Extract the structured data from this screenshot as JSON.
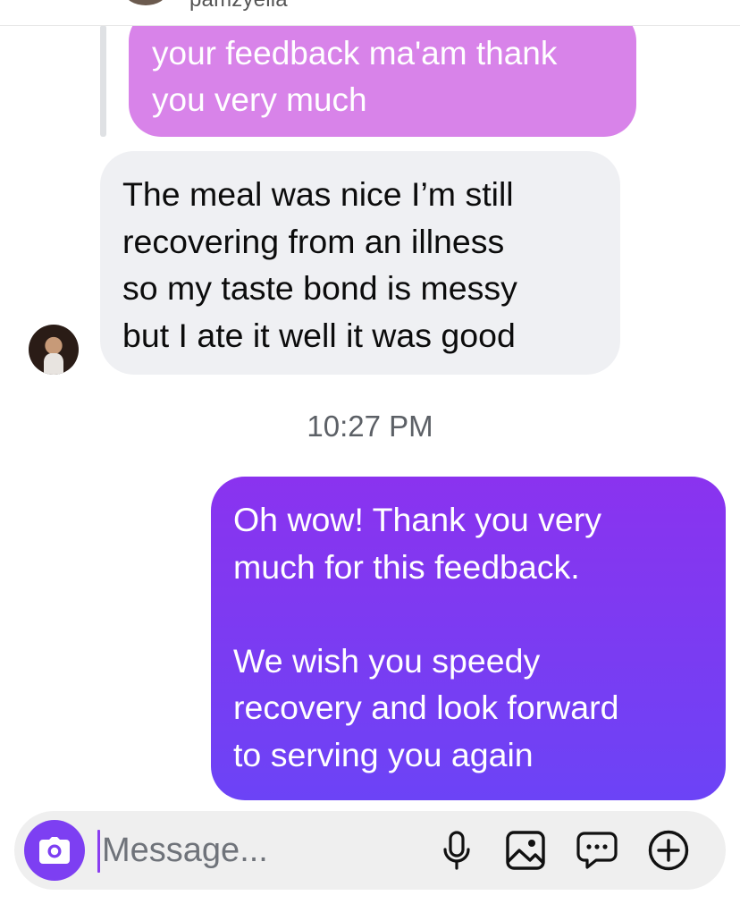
{
  "header": {
    "username": "pamzyella"
  },
  "thread": {
    "quoted_message": {
      "lines": [
        "your feedback ma'am thank",
        "you very much"
      ]
    },
    "received_message": {
      "lines": [
        "The meal was nice I’m still",
        "recovering from an illness",
        "so my taste bond is messy",
        "but I ate it well it was good"
      ]
    },
    "timestamp": "10:27 PM",
    "sent_message": {
      "paragraph1": [
        "Oh wow! Thank you very",
        "much for this feedback."
      ],
      "paragraph2": [
        "We wish you speedy",
        "recovery and look forward",
        "to serving you again"
      ]
    }
  },
  "composer": {
    "placeholder": "Message...",
    "value": "",
    "icons": [
      "camera-icon",
      "microphone-icon",
      "gallery-icon",
      "sticker-chat-icon",
      "add-icon"
    ]
  },
  "colors": {
    "quoted_bubble": "#d883e9",
    "received_bubble": "#eff0f3",
    "sent_bubble_top": "#8a33ef",
    "sent_bubble_bottom": "#6c43f6",
    "accent": "#7d3ff2"
  }
}
